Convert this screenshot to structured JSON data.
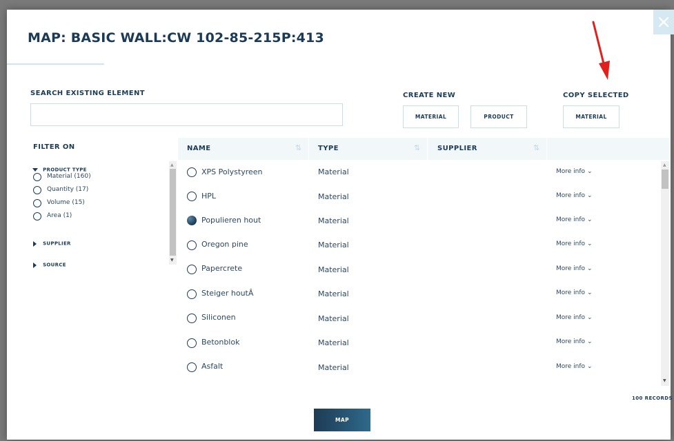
{
  "modal": {
    "title": "MAP: BASIC WALL:CW 102-85-215P:413",
    "close_icon": "close-icon"
  },
  "search": {
    "label": "SEARCH EXISTING ELEMENT",
    "value": "",
    "placeholder": ""
  },
  "create_new": {
    "label": "CREATE NEW",
    "material_label": "MATERIAL",
    "product_label": "PRODUCT"
  },
  "copy_selected": {
    "label": "COPY SELECTED",
    "material_label": "MATERIAL"
  },
  "filter": {
    "title": "FILTER ON",
    "product_type_label": "PRODUCT TYPE",
    "options": [
      {
        "label": "Material (160)"
      },
      {
        "label": "Quantity (17)"
      },
      {
        "label": "Volume (15)"
      },
      {
        "label": "Area (1)"
      }
    ],
    "supplier_label": "SUPPLIER",
    "source_label": "SOURCE"
  },
  "table": {
    "headers": {
      "name": "NAME",
      "type": "TYPE",
      "supplier": "SUPPLIER"
    },
    "rows": [
      {
        "name": "XPS Polystyreen",
        "type": "Material",
        "supplier": "",
        "more": "More info",
        "selected": false
      },
      {
        "name": "HPL",
        "type": "Material",
        "supplier": "",
        "more": "More info",
        "selected": false
      },
      {
        "name": "Populieren hout",
        "type": "Material",
        "supplier": "",
        "more": "More info",
        "selected": true
      },
      {
        "name": "Oregon pine",
        "type": "Material",
        "supplier": "",
        "more": "More info",
        "selected": false
      },
      {
        "name": "Papercrete",
        "type": "Material",
        "supplier": "",
        "more": "More info",
        "selected": false
      },
      {
        "name": "Steiger houtÂ",
        "type": "Material",
        "supplier": "",
        "more": "More info",
        "selected": false
      },
      {
        "name": "Siliconen",
        "type": "Material",
        "supplier": "",
        "more": "More info",
        "selected": false
      },
      {
        "name": "Betonblok",
        "type": "Material",
        "supplier": "",
        "more": "More info",
        "selected": false
      },
      {
        "name": "Asfalt",
        "type": "Material",
        "supplier": "",
        "more": "More info",
        "selected": false
      }
    ],
    "records": "100 RECORDS"
  },
  "footer": {
    "map_label": "MAP"
  },
  "colors": {
    "navy": "#1d3b55",
    "arrow": "#e0201b",
    "accent_light": "#cfe4ef"
  }
}
